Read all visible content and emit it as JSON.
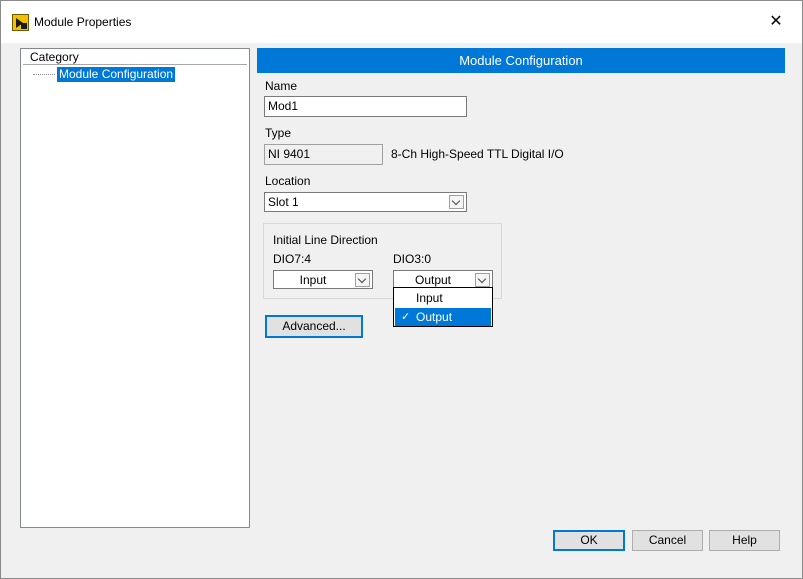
{
  "window": {
    "title": "Module Properties",
    "app_icon": "labview-project-icon",
    "close_glyph": "✕"
  },
  "sidebar": {
    "header": "Category",
    "items": [
      {
        "label": "Module Configuration",
        "selected": true
      }
    ]
  },
  "section": {
    "title": "Module Configuration"
  },
  "form": {
    "name_label": "Name",
    "name_value": "Mod1",
    "type_label": "Type",
    "type_value": "NI 9401",
    "type_description": "8-Ch High-Speed TTL Digital I/O",
    "location_label": "Location",
    "location_value": "Slot 1"
  },
  "line_direction": {
    "title": "Initial Line Direction",
    "dio74_label": "DIO7:4",
    "dio74_value": "Input",
    "dio30_label": "DIO3:0",
    "dio30_value": "Output",
    "dropdown_options": [
      {
        "label": "Input",
        "selected": false
      },
      {
        "label": "Output",
        "selected": true
      }
    ],
    "check_glyph": "✓"
  },
  "buttons": {
    "advanced": "Advanced...",
    "ok": "OK",
    "cancel": "Cancel",
    "help": "Help"
  },
  "colors": {
    "accent": "#0078d7",
    "window_bg": "#f0f0f0"
  }
}
